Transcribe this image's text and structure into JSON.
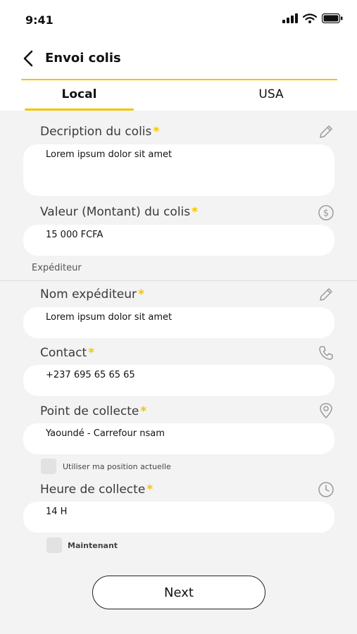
{
  "status_bar": {
    "time": "9:41"
  },
  "header": {
    "title": "Envoi colis"
  },
  "tabs": [
    {
      "label": "Local",
      "active": true
    },
    {
      "label": "USA",
      "active": false
    }
  ],
  "fields": {
    "description": {
      "label": "Decription du colis",
      "value": "Lorem ipsum dolor sit amet",
      "icon": "pencil-icon"
    },
    "valeur": {
      "label": "Valeur (Montant) du colis",
      "value": "15 000 FCFA",
      "icon": "dollar-icon"
    },
    "nom": {
      "label": "Nom expéditeur",
      "value": "Lorem ipsum dolor sit amet",
      "icon": "pencil-icon"
    },
    "contact": {
      "label": "Contact",
      "value": "+237 695 65 65 65",
      "icon": "phone-icon"
    },
    "point": {
      "label": "Point de collecte",
      "value": "Yaoundé - Carrefour nsam",
      "icon": "location-pin-icon"
    },
    "heure": {
      "label": "Heure de collecte",
      "value": "14 H",
      "icon": "clock-icon"
    }
  },
  "required_mark": "*",
  "section_expediteur": "Expéditeur",
  "checkboxes": {
    "position": {
      "label": "Utiliser ma position actuelle",
      "checked": false
    },
    "maintenant": {
      "label": "Maintenant",
      "checked": false
    }
  },
  "next_button": "Next",
  "colors": {
    "accent": "#f5c400",
    "background": "#f3f3f3",
    "field": "#ffffff"
  }
}
